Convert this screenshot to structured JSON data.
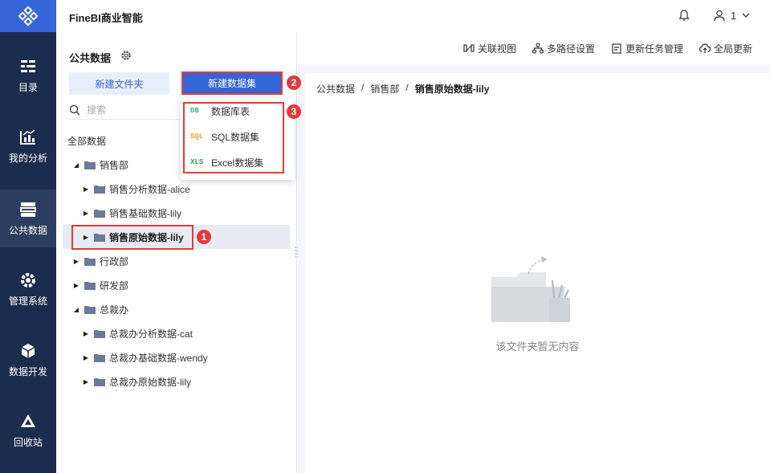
{
  "app": {
    "title": "FineBI商业智能"
  },
  "user": {
    "name": "1"
  },
  "nav": [
    {
      "label": "目录",
      "icon": "catalog-icon"
    },
    {
      "label": "我的分析",
      "icon": "analysis-icon"
    },
    {
      "label": "公共数据",
      "icon": "public-data-icon"
    },
    {
      "label": "管理系统",
      "icon": "gear-icon"
    },
    {
      "label": "数据开发",
      "icon": "data-dev-icon"
    },
    {
      "label": "回收站",
      "icon": "recycle-icon"
    }
  ],
  "left": {
    "title": "公共数据",
    "new_folder": "新建文件夹",
    "new_dataset": "新建数据集",
    "search_placeholder": "搜索",
    "root": "全部数据",
    "tree": [
      {
        "label": "销售部"
      },
      {
        "label": "销售分析数据-alice"
      },
      {
        "label": "销售基础数据-lily"
      },
      {
        "label": "销售原始数据-lily"
      },
      {
        "label": "行政部"
      },
      {
        "label": "研发部"
      },
      {
        "label": "总裁办"
      },
      {
        "label": "总裁办分析数据-cat"
      },
      {
        "label": "总裁办基础数据-wendy"
      },
      {
        "label": "总裁办原始数据-lily"
      }
    ]
  },
  "dropdown": [
    {
      "tag": "DB",
      "label": "数据库表",
      "color": "#37b4a0"
    },
    {
      "tag": "SQL",
      "label": "SQL数据集",
      "color": "#f0a030"
    },
    {
      "tag": "XLS",
      "label": "Excel数据集",
      "color": "#2e9b4a"
    }
  ],
  "badges": [
    "1",
    "2",
    "3"
  ],
  "toolbar": {
    "relation_view": "关联视图",
    "multipath": "多路径设置",
    "update_task": "更新任务管理",
    "global_update": "全局更新"
  },
  "breadcrumb": [
    "公共数据",
    "/",
    "销售部",
    "/",
    "销售原始数据-lily"
  ],
  "empty_text": "该文件夹暂无内容",
  "colors": {
    "nav_bg": "#1a2d4d",
    "accent": "#3565d7",
    "highlight": "#e33b3b"
  }
}
